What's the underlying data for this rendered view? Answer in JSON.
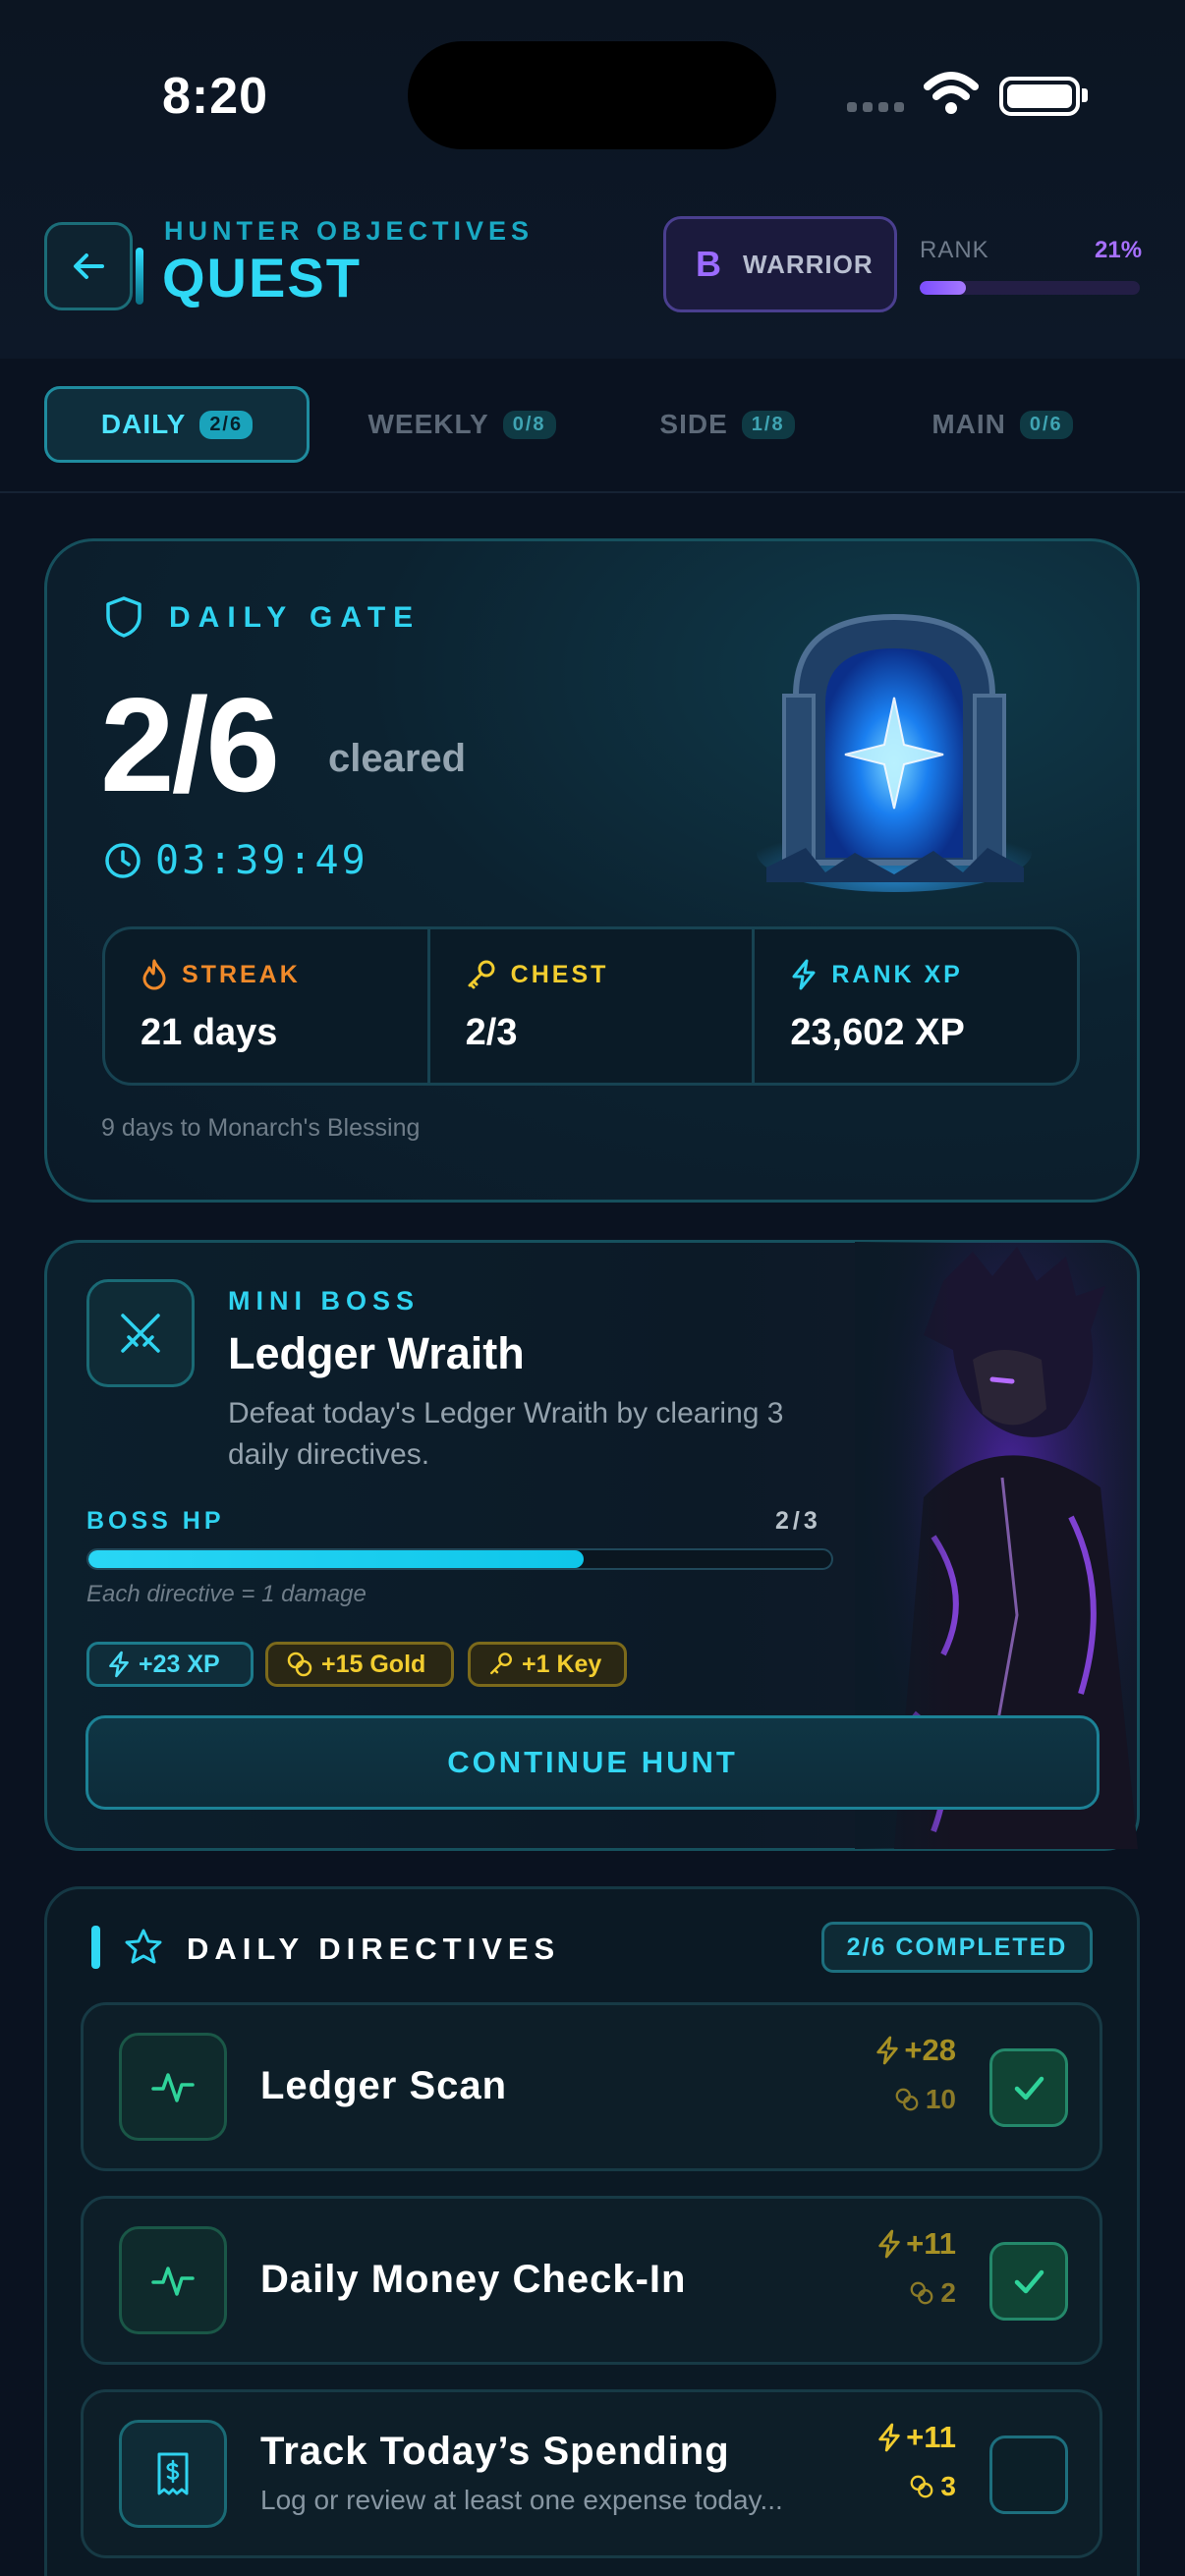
{
  "status_bar": {
    "time": "8:20"
  },
  "header": {
    "subtitle": "HUNTER OBJECTIVES",
    "title": "QUEST",
    "class_badge": {
      "letter": "B",
      "name": "WARRIOR"
    },
    "rank": {
      "label": "RANK",
      "percent_text": "21%",
      "progress": 0.21
    }
  },
  "tabs": [
    {
      "label": "DAILY",
      "count": "2/6",
      "active": true
    },
    {
      "label": "WEEKLY",
      "count": "0/8",
      "active": false
    },
    {
      "label": "SIDE",
      "count": "1/8",
      "active": false
    },
    {
      "label": "MAIN",
      "count": "0/6",
      "active": false
    }
  ],
  "daily_gate": {
    "label": "DAILY GATE",
    "progress": "2/6",
    "progress_suffix": "cleared",
    "timer": "03:39:49",
    "stats": [
      {
        "label": "STREAK",
        "value": "21 days",
        "icon": "flame-icon",
        "color": "#f08a2a"
      },
      {
        "label": "CHEST",
        "value": "2/3",
        "icon": "key-icon",
        "color": "#f2cd2f"
      },
      {
        "label": "RANK XP",
        "value": "23,602 XP",
        "icon": "lightning-icon",
        "color": "#2fd3f0"
      }
    ],
    "footnote": "9 days to Monarch's Blessing"
  },
  "mini_boss": {
    "kicker": "MINI BOSS",
    "name": "Ledger Wraith",
    "description": "Defeat today's Ledger Wraith by clearing 3 daily directives.",
    "hp_label": "BOSS HP",
    "hp_value": "2/3",
    "hp_progress": 0.667,
    "hp_note": "Each directive = 1 damage",
    "rewards": {
      "xp": "+23 XP",
      "gold": "+15 Gold",
      "key": "+1 Key"
    },
    "cta": "CONTINUE HUNT"
  },
  "directives": {
    "title": "DAILY DIRECTIVES",
    "badge": "2/6 COMPLETED",
    "items": [
      {
        "name": "Ledger Scan",
        "subtitle": "",
        "xp": "+28",
        "gold": "10",
        "completed": true,
        "icon": "pulse-icon"
      },
      {
        "name": "Daily Money Check-In",
        "subtitle": "",
        "xp": "+11",
        "gold": "2",
        "completed": true,
        "icon": "pulse-icon"
      },
      {
        "name": "Track Today’s Spending",
        "subtitle": "Log or review at least one expense today...",
        "xp": "+11",
        "gold": "3",
        "completed": false,
        "icon": "receipt-icon"
      }
    ]
  },
  "colors": {
    "accent": "#2fd8f5",
    "purple": "#9b6bff",
    "gold": "#f2cd2f",
    "success": "#2fd39a"
  }
}
